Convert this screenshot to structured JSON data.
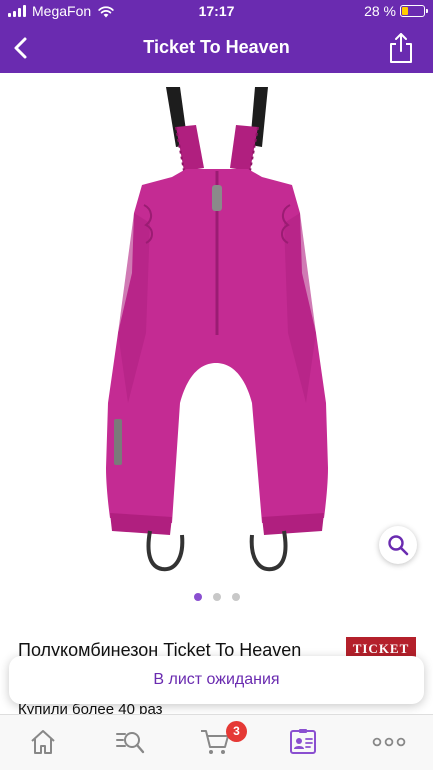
{
  "status_bar": {
    "carrier": "MegaFon",
    "time": "17:17",
    "battery_percent": "28 %",
    "battery_level": 0.28
  },
  "header": {
    "title": "Ticket To Heaven",
    "background": "#6a2bb0"
  },
  "gallery": {
    "image_count": 3,
    "active_index": 0,
    "product_color": "#c42b93"
  },
  "product": {
    "name": "Полукомбинезон Ticket To Heaven",
    "brand_logo_text": "TICKET",
    "bought_text": "Купили более 40 раз"
  },
  "actions": {
    "waitlist_label": "В лист ожидания"
  },
  "tabbar": {
    "cart_badge": "3",
    "icons": [
      "home-icon",
      "search-icon",
      "cart-icon",
      "profile-card-icon",
      "more-icon"
    ]
  }
}
